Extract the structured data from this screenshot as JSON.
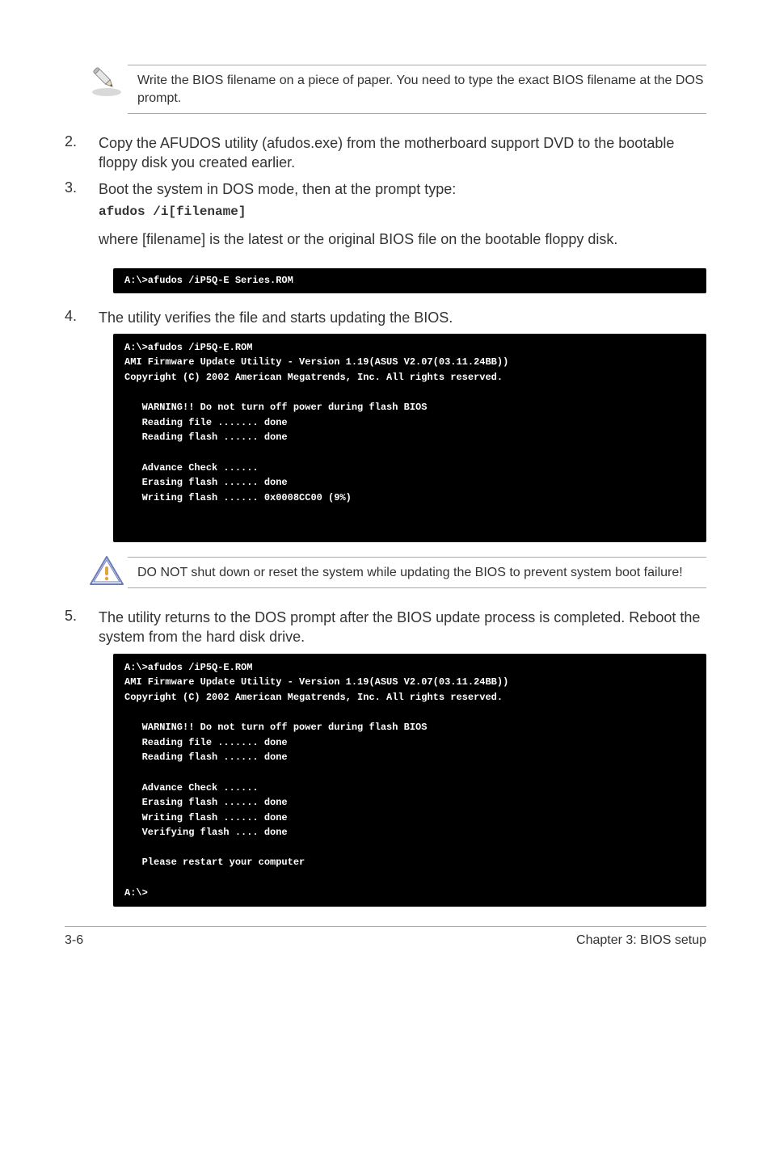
{
  "note1": "Write the BIOS filename on a piece of paper. You need to type the exact BIOS filename at the DOS prompt.",
  "step2": {
    "num": "2.",
    "text": "Copy the AFUDOS utility (afudos.exe) from the motherboard support DVD to the bootable floppy disk you created earlier."
  },
  "step3": {
    "num": "3.",
    "text": "Boot the system in DOS mode, then at the prompt type:",
    "cmd": "afudos /i[filename]",
    "para": "where [filename] is the latest or the original BIOS file on the bootable floppy disk."
  },
  "term1": "A:\\>afudos /iP5Q-E Series.ROM",
  "step4": {
    "num": "4.",
    "text": "The utility verifies the file and starts updating the BIOS."
  },
  "term2": "A:\\>afudos /iP5Q-E.ROM\nAMI Firmware Update Utility - Version 1.19(ASUS V2.07(03.11.24BB))\nCopyright (C) 2002 American Megatrends, Inc. All rights reserved.\n\n   WARNING!! Do not turn off power during flash BIOS\n   Reading file ....... done\n   Reading flash ...... done\n\n   Advance Check ......\n   Erasing flash ...... done\n   Writing flash ...... 0x0008CC00 (9%)\n\n\n",
  "note2": "DO NOT shut down or reset the system while updating the BIOS to prevent system boot failure!",
  "step5": {
    "num": "5.",
    "text": "The utility returns to the DOS prompt after the BIOS update process is completed. Reboot the system from the hard disk drive."
  },
  "term3": "A:\\>afudos /iP5Q-E.ROM\nAMI Firmware Update Utility - Version 1.19(ASUS V2.07(03.11.24BB))\nCopyright (C) 2002 American Megatrends, Inc. All rights reserved.\n\n   WARNING!! Do not turn off power during flash BIOS\n   Reading file ....... done\n   Reading flash ...... done\n\n   Advance Check ......\n   Erasing flash ...... done\n   Writing flash ...... done\n   Verifying flash .... done\n\n   Please restart your computer\n\nA:\\>",
  "footer": {
    "left": "3-6",
    "right": "Chapter 3: BIOS setup"
  }
}
